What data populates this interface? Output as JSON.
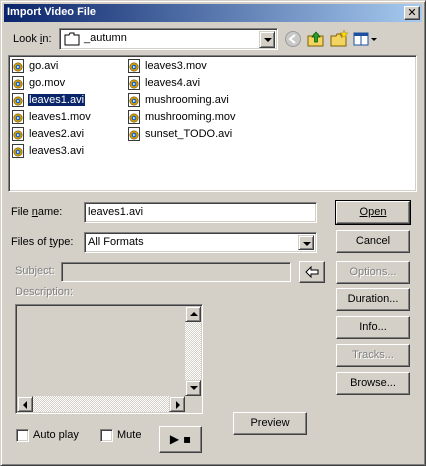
{
  "window": {
    "title": "Import Video File",
    "close_glyph": "✕"
  },
  "lookin": {
    "label_pre": "Look ",
    "label_key": "i",
    "label_post": "n:",
    "value": "_autumn",
    "icons": [
      "folder-icon",
      "back-arrow-icon",
      "up-folder-icon",
      "new-folder-icon",
      "view-menu-icon"
    ]
  },
  "files": [
    {
      "name": "go.avi",
      "selected": false
    },
    {
      "name": "go.mov",
      "selected": false
    },
    {
      "name": "leaves1.avi",
      "selected": true
    },
    {
      "name": "leaves1.mov",
      "selected": false
    },
    {
      "name": "leaves2.avi",
      "selected": false
    },
    {
      "name": "leaves3.avi",
      "selected": false
    },
    {
      "name": "leaves3.mov",
      "selected": false
    },
    {
      "name": "leaves4.avi",
      "selected": false
    },
    {
      "name": "mushrooming.avi",
      "selected": false
    },
    {
      "name": "mushrooming.mov",
      "selected": false
    },
    {
      "name": "sunset_TODO.avi",
      "selected": false
    }
  ],
  "filename": {
    "label_pre": "File ",
    "label_key": "n",
    "label_post": "ame:",
    "value": "leaves1.avi"
  },
  "filetype": {
    "label_pre": "Files of ",
    "label_key": "t",
    "label_post": "ype:",
    "value": "All Formats"
  },
  "subject": {
    "label": "Subject:",
    "value": ""
  },
  "description": {
    "label": "Description:",
    "value": ""
  },
  "buttons": {
    "open": "Open",
    "cancel": "Cancel",
    "options": "Options...",
    "duration": "Duration...",
    "info": "Info...",
    "tracks": "Tracks...",
    "browse": "Browse...",
    "preview": "Preview",
    "play_glyph": "▶ ▪"
  },
  "checkboxes": {
    "autoplay": "Auto play",
    "mute": "Mute"
  }
}
